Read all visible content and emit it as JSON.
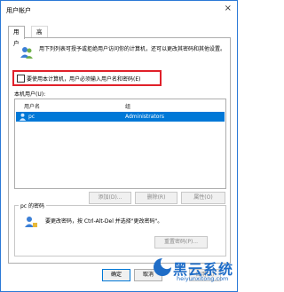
{
  "window": {
    "title": "用户帐户",
    "close_glyph": "×"
  },
  "tabs": [
    {
      "label": "用户"
    },
    {
      "label": "高级"
    }
  ],
  "intro": "用下列列表可授予或拒绝用户访问你的计算机，还可以更改其密码和其他设置。",
  "require_password": {
    "checked": false,
    "label": "要使用本计算机，用户必须输入用户名和密码(E)"
  },
  "users_section": {
    "label": "本机用户(U):",
    "columns": [
      "用户名",
      "组"
    ],
    "rows": [
      {
        "name": "pc",
        "group": "Administrators",
        "selected": true
      }
    ]
  },
  "buttons": {
    "add": "添加(D)...",
    "remove": "删除(R)",
    "properties": "属性(O)"
  },
  "password_group": {
    "title": "pc 的密码",
    "text": "要更改密码，按 Ctrl-Alt-Del 并选择\"更改密码\"。",
    "reset": "重置密码(P)..."
  },
  "footer": {
    "ok": "确定",
    "cancel": "取消",
    "apply": "应用(A)"
  },
  "watermark": {
    "text": "黑云系统",
    "url": "heiyunxitong.com"
  },
  "colors": {
    "accent": "#0078d7",
    "highlight_box": "#e0202a",
    "watermark": "#1f6dc7"
  }
}
